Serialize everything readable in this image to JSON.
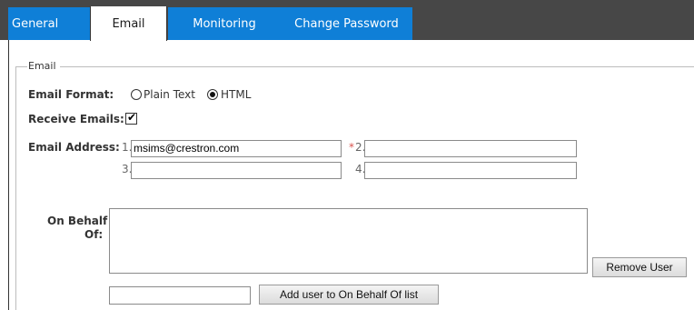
{
  "tabs": {
    "general": "General",
    "email": "Email",
    "monitoring": "Monitoring",
    "change_password": "Change Password"
  },
  "email_section": {
    "legend": "Email",
    "format_label": "Email Format:",
    "format_options": [
      "Plain Text",
      "HTML"
    ],
    "format_selected": "HTML",
    "receive_label": "Receive Emails:",
    "receive_checked": true,
    "address_label": "Email Address:",
    "address_numbers": [
      "1.",
      "2.",
      "3.",
      "4."
    ],
    "required_marker": "*",
    "addresses": [
      "msims@crestron.com",
      "",
      "",
      ""
    ]
  },
  "behalf": {
    "label_line1": "On Behalf",
    "label_line2": "Of:",
    "remove_button": "Remove User",
    "add_input_value": "",
    "add_button": "Add user to On Behalf Of list"
  },
  "colors": {
    "tab_blue": "#0f7fd7",
    "tabbar_bg": "#474747",
    "required": "#d9534f"
  }
}
